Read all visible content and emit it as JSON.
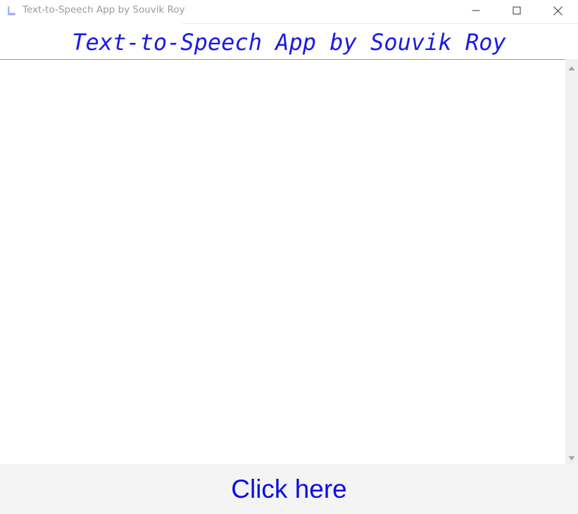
{
  "window": {
    "title": "Text-to-Speech App by Souvik Roy",
    "app_icon": "app-logo-icon",
    "controls": {
      "minimize_icon": "minimize-icon",
      "maximize_icon": "maximize-icon",
      "close_icon": "close-icon"
    }
  },
  "header": {
    "label": "Text-to-Speech App by Souvik Roy",
    "color": "#1a1ae6"
  },
  "text_input": {
    "value": "",
    "placeholder": ""
  },
  "scrollbar": {
    "up_icon": "scroll-up-arrow-icon",
    "down_icon": "scroll-down-arrow-icon"
  },
  "action": {
    "button_label": "Click here",
    "color": "#0b0bf0"
  }
}
